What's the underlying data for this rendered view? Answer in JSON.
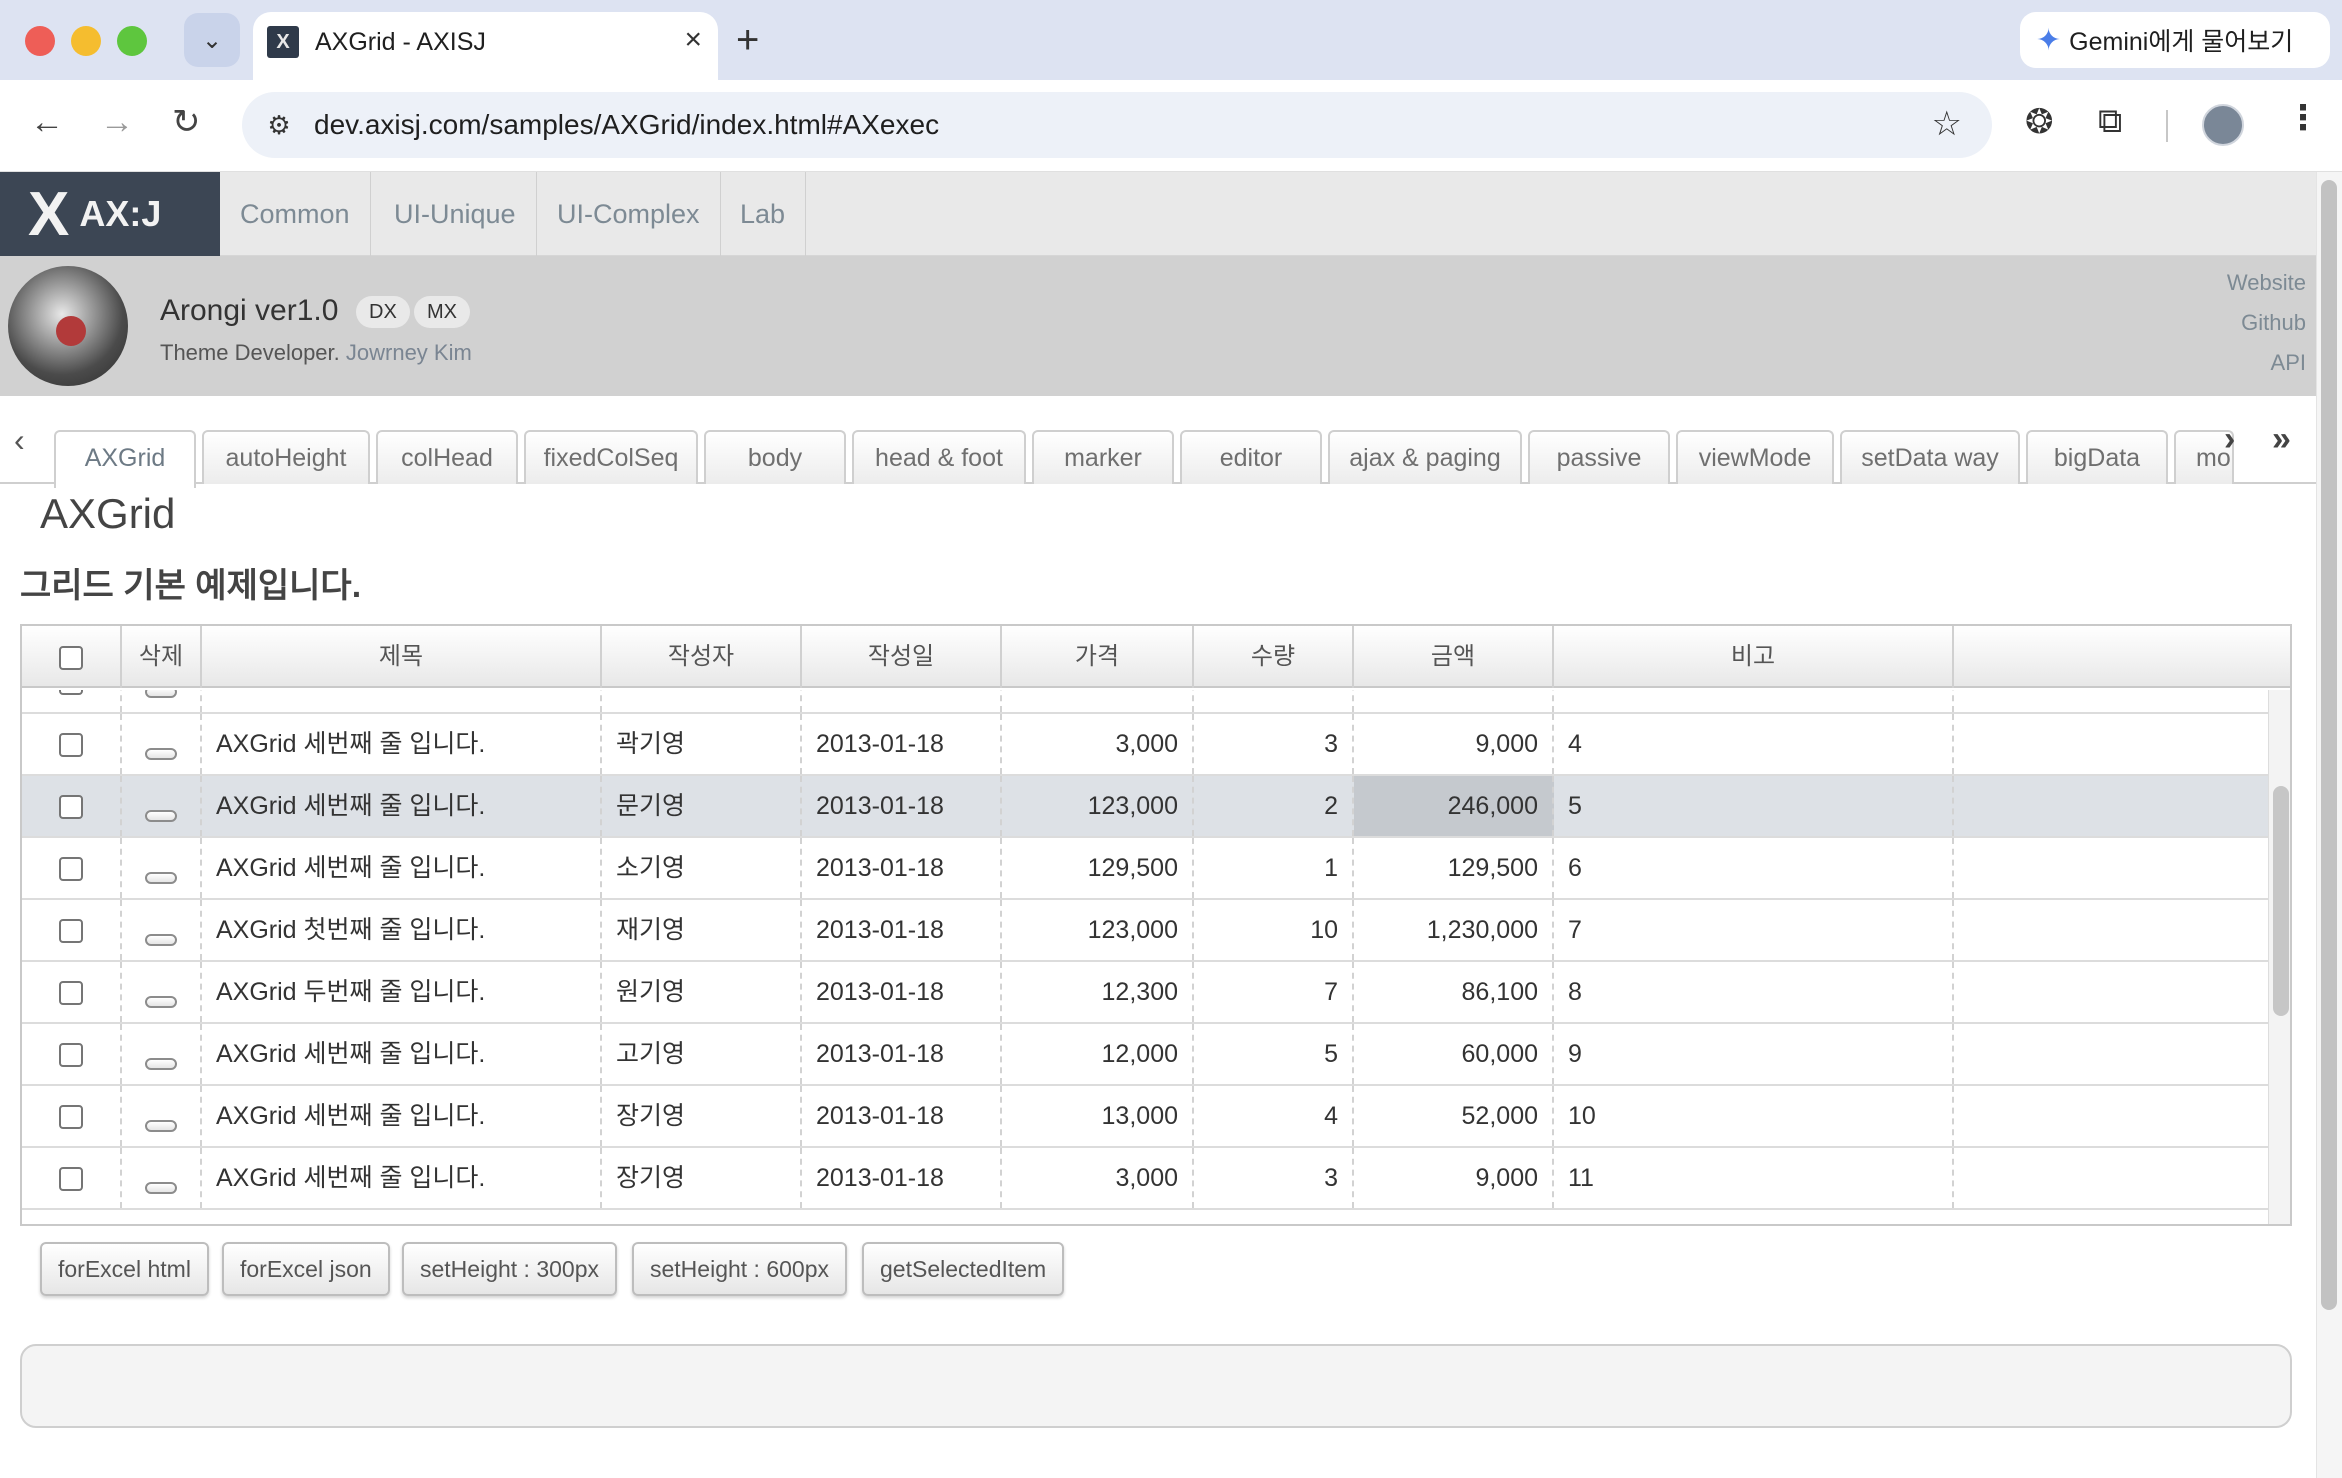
{
  "browser": {
    "tab_title": "AXGrid - AXISJ",
    "favicon_label": "X",
    "url": "dev.axisj.com/samples/AXGrid/index.html#AXexec",
    "gemini_label": "Gemini에게 물어보기"
  },
  "site": {
    "logo_text": "AX:J",
    "menu": [
      "Common",
      "UI-Unique",
      "UI-Complex",
      "Lab"
    ]
  },
  "profile": {
    "theme_name": "Arongi ver1.0",
    "badges": [
      "DX",
      "MX"
    ],
    "developer_prefix": "Theme Developer.",
    "developer_name": "Jowrney Kim",
    "links": [
      "Website",
      "Github",
      "API"
    ]
  },
  "sample_tabs": [
    "AXGrid",
    "autoHeight",
    "colHead",
    "fixedColSeq",
    "body",
    "head & foot",
    "marker",
    "editor",
    "ajax & paging",
    "passive",
    "viewMode",
    "setData way",
    "bigData",
    "mo"
  ],
  "active_tab": "AXGrid",
  "page": {
    "title": "AXGrid",
    "subtitle": "그리드 기본 예제입니다."
  },
  "grid": {
    "columns": [
      "",
      "삭제",
      "제목",
      "작성자",
      "작성일",
      "가격",
      "수량",
      "금액",
      "비고"
    ],
    "rows": [
      {
        "title": "AXGrid 세번째 줄 입니다.",
        "author": "곽기영",
        "date": "2013-01-18",
        "price": "3,000",
        "qty": "3",
        "amount": "9,000",
        "note": "4"
      },
      {
        "title": "AXGrid 세번째 줄 입니다.",
        "author": "문기영",
        "date": "2013-01-18",
        "price": "123,000",
        "qty": "2",
        "amount": "246,000",
        "note": "5"
      },
      {
        "title": "AXGrid 세번째 줄 입니다.",
        "author": "소기영",
        "date": "2013-01-18",
        "price": "129,500",
        "qty": "1",
        "amount": "129,500",
        "note": "6"
      },
      {
        "title": "AXGrid 첫번째 줄 입니다.",
        "author": "재기영",
        "date": "2013-01-18",
        "price": "123,000",
        "qty": "10",
        "amount": "1,230,000",
        "note": "7"
      },
      {
        "title": "AXGrid 두번째 줄 입니다.",
        "author": "원기영",
        "date": "2013-01-18",
        "price": "12,300",
        "qty": "7",
        "amount": "86,100",
        "note": "8"
      },
      {
        "title": "AXGrid 세번째 줄 입니다.",
        "author": "고기영",
        "date": "2013-01-18",
        "price": "12,000",
        "qty": "5",
        "amount": "60,000",
        "note": "9"
      },
      {
        "title": "AXGrid 세번째 줄 입니다.",
        "author": "장기영",
        "date": "2013-01-18",
        "price": "13,000",
        "qty": "4",
        "amount": "52,000",
        "note": "10"
      },
      {
        "title": "AXGrid 세번째 줄 입니다.",
        "author": "장기영",
        "date": "2013-01-18",
        "price": "3,000",
        "qty": "3",
        "amount": "9,000",
        "note": "11"
      }
    ],
    "selected_row": "5"
  },
  "actions": [
    "forExcel html",
    "forExcel json",
    "setHeight : 300px",
    "setHeight : 600px",
    "getSelectedItem"
  ]
}
